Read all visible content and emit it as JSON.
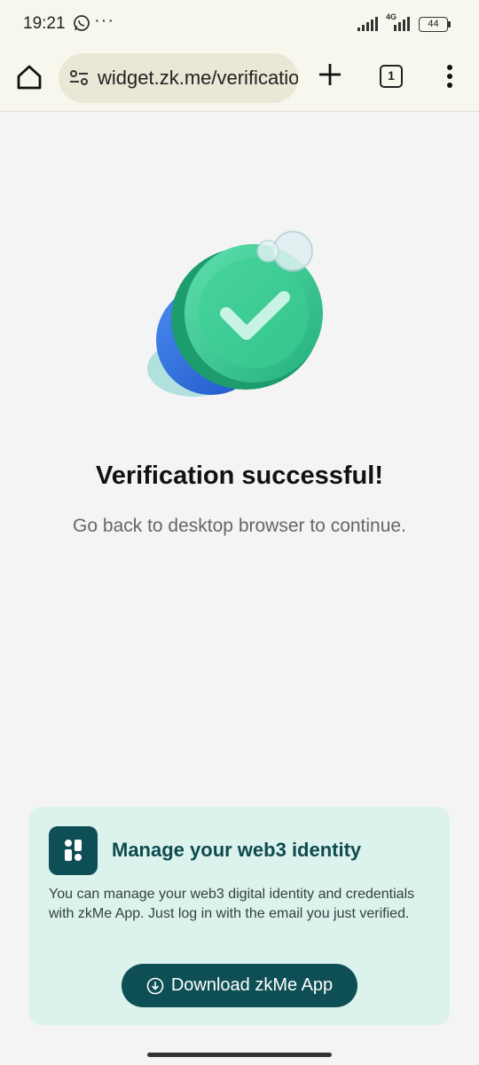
{
  "status_bar": {
    "time": "19:21",
    "more": "···",
    "network": "4G",
    "battery": "44"
  },
  "browser": {
    "url": "widget.zk.me/verification",
    "tab_count": "1",
    "icons": [
      "home-icon",
      "site-settings-icon",
      "plus-icon",
      "tabs-icon",
      "more-vert-icon"
    ]
  },
  "main": {
    "title": "Verification successful!",
    "subtitle": "Go back to desktop browser to continue."
  },
  "promo": {
    "title": "Manage your web3 identity",
    "description": "You can manage your web3 digital identity and credentials with zkMe App. Just log in with the email you just verified.",
    "button_label": "Download zkMe App"
  },
  "colors": {
    "accent": "#0e4f55",
    "card_bg": "#dcf2ec",
    "coin_green": "#3ccf95",
    "coin_blue": "#2f6fe0"
  }
}
